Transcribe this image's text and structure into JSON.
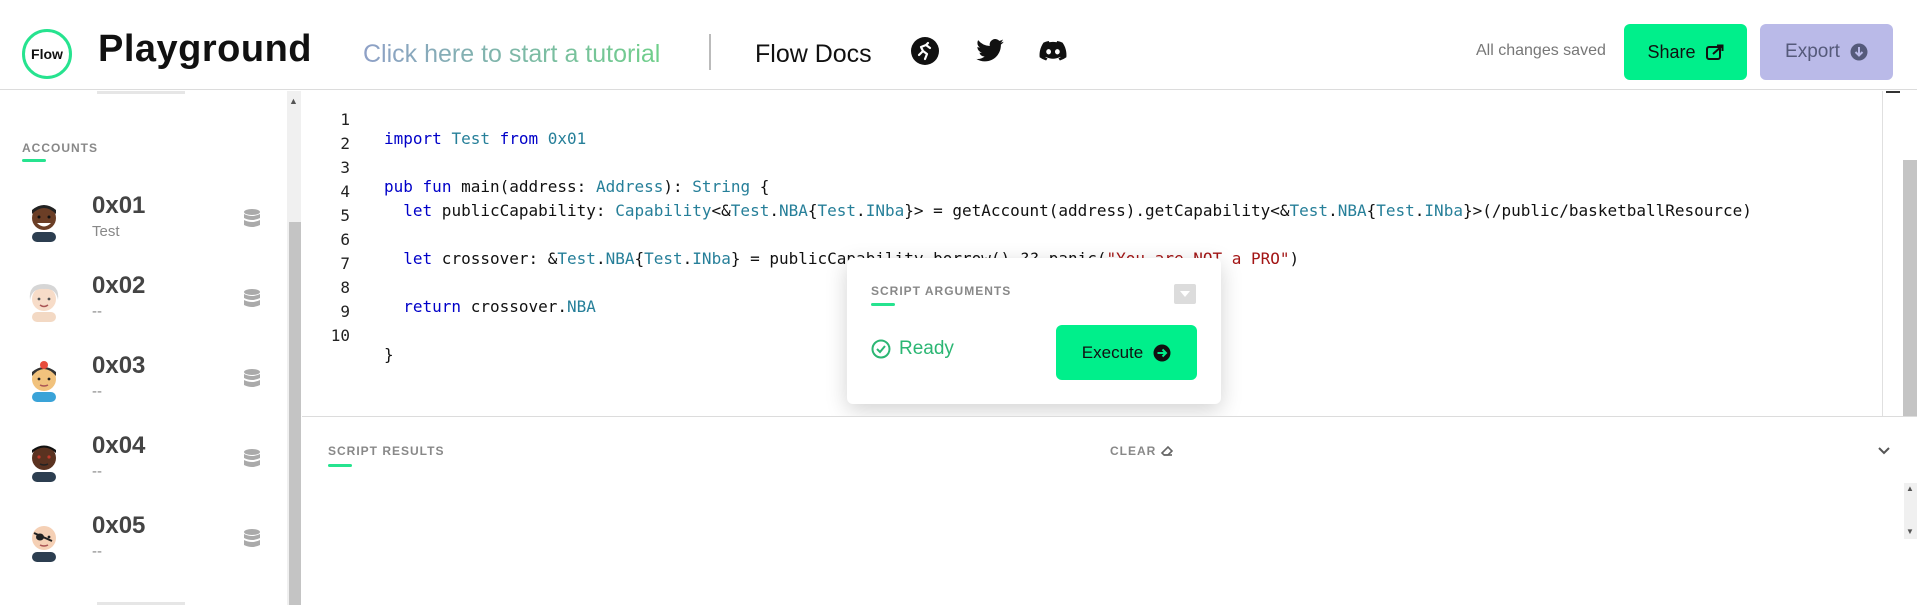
{
  "header": {
    "logo_text": "Flow",
    "title": "Playground",
    "tutorial_link": "Click here to start a tutorial",
    "docs_link": "Flow Docs",
    "save_status": "All changes saved",
    "share_label": "Share",
    "export_label": "Export",
    "icons": [
      "flow-runner-icon",
      "twitter-icon",
      "discord-icon"
    ]
  },
  "sidebar": {
    "accounts_title": "ACCOUNTS",
    "accounts": [
      {
        "address": "0x01",
        "subtitle": "Test"
      },
      {
        "address": "0x02",
        "subtitle": "--"
      },
      {
        "address": "0x03",
        "subtitle": "--"
      },
      {
        "address": "0x04",
        "subtitle": "--"
      },
      {
        "address": "0x05",
        "subtitle": "--"
      }
    ]
  },
  "editor": {
    "line_numbers": [
      "1",
      "2",
      "3",
      "4",
      "5",
      "6",
      "7",
      "8",
      "9",
      "10"
    ],
    "lines": [
      "import Test from 0x01",
      "",
      "pub fun main(address: Address): String {",
      "  let publicCapability: Capability<&Test.NBA{Test.INba}> = getAccount(address).getCapability<&Test.NBA{Test.INba}>(/public/basketballResource)",
      "",
      "  let crossover: &Test.NBA{Test.INba} = publicCapability.borrow() ?? panic(\"You are NOT a PRO\")",
      "",
      "  return crossover.NBA",
      "",
      "}"
    ]
  },
  "script_arguments": {
    "title": "SCRIPT ARGUMENTS",
    "status": "Ready",
    "execute_label": "Execute"
  },
  "results": {
    "title": "SCRIPT RESULTS",
    "clear_label": "CLEAR"
  },
  "colors": {
    "accent": "#00ef8b",
    "export": "#babae8",
    "ready": "#2bb673"
  }
}
